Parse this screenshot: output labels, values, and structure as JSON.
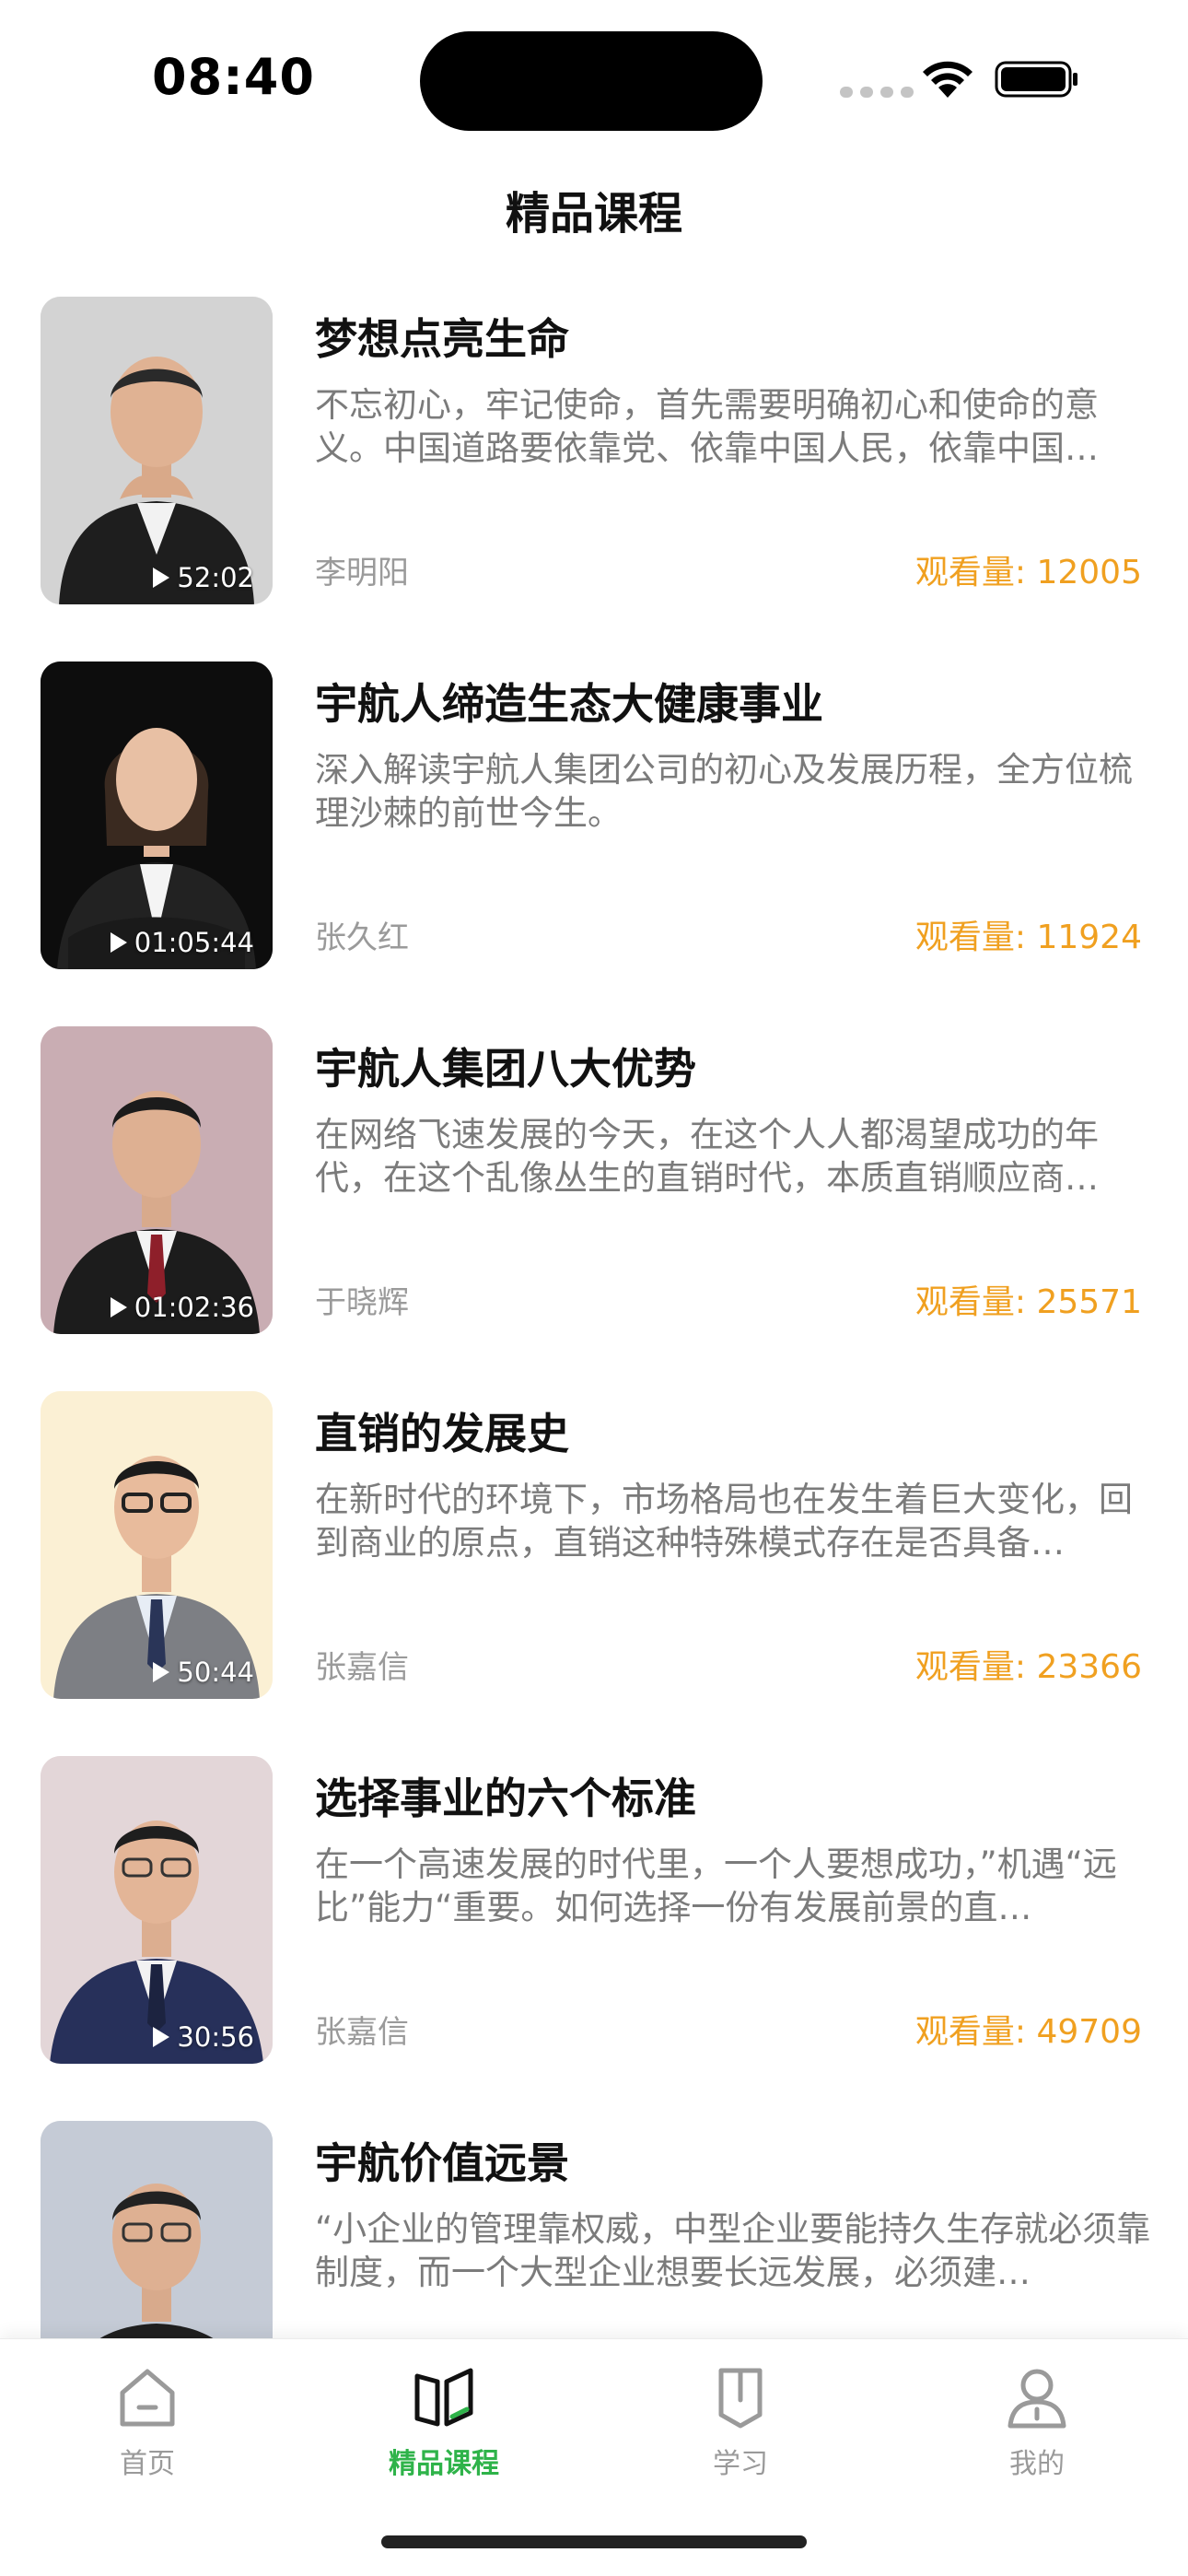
{
  "status_bar": {
    "time": "08:40"
  },
  "header": {
    "title": "精品课程"
  },
  "courses": [
    {
      "title": "梦想点亮生命",
      "description": "不忘初心，牢记使命，首先需要明确初心和使命的意义。中国道路要依靠党、依靠中国人民，依靠中国…",
      "author": "李明阳",
      "views": "观看量: 12005",
      "duration": "52:02",
      "bg_color": "#d3d3d3"
    },
    {
      "title": "宇航人缔造生态大健康事业",
      "description": "深入解读宇航人集团公司的初心及发展历程，全方位梳理沙棘的前世今生。",
      "author": "张久红",
      "views": "观看量: 11924",
      "duration": "01:05:44",
      "bg_color": "#0d0d0d"
    },
    {
      "title": "宇航人集团八大优势",
      "description": "在网络飞速发展的今天，在这个人人都渴望成功的年代，在这个乱像丛生的直销时代，本质直销顺应商…",
      "author": "于晓辉",
      "views": "观看量: 25571",
      "duration": "01:02:36",
      "bg_color": "#c9adb3"
    },
    {
      "title": "直销的发展史",
      "description": "在新时代的环境下，市场格局也在发生着巨大变化，回到商业的原点，直销这种特殊模式存在是否具备…",
      "author": "张嘉信",
      "views": "观看量: 23366",
      "duration": "50:44",
      "bg_color": "#fbf0d4"
    },
    {
      "title": "选择事业的六个标准",
      "description": "在一个高速发展的时代里，一个人要想成功，”机遇“远比”能力“重要。如何选择一份有发展前景的直…",
      "author": "张嘉信",
      "views": "观看量: 49709",
      "duration": "30:56",
      "bg_color": "#e3d6d8"
    },
    {
      "title": "宇航价值远景",
      "description": "“小企业的管理靠权威，中型企业要能持久生存就必须靠制度，而一个大型企业想要长远发展，必须建…",
      "author": "",
      "views": "",
      "duration": "",
      "bg_color": "#c5cbd6"
    }
  ],
  "tab_bar": {
    "tabs": [
      {
        "label": "首页",
        "icon": "home-icon",
        "active": false
      },
      {
        "label": "精品课程",
        "icon": "book-icon",
        "active": true
      },
      {
        "label": "学习",
        "icon": "bookmark-icon",
        "active": false
      },
      {
        "label": "我的",
        "icon": "user-icon",
        "active": false
      }
    ]
  },
  "colors": {
    "accent": "#2fb34a",
    "views": "#f0a020",
    "muted_text": "#7b7b7b"
  }
}
